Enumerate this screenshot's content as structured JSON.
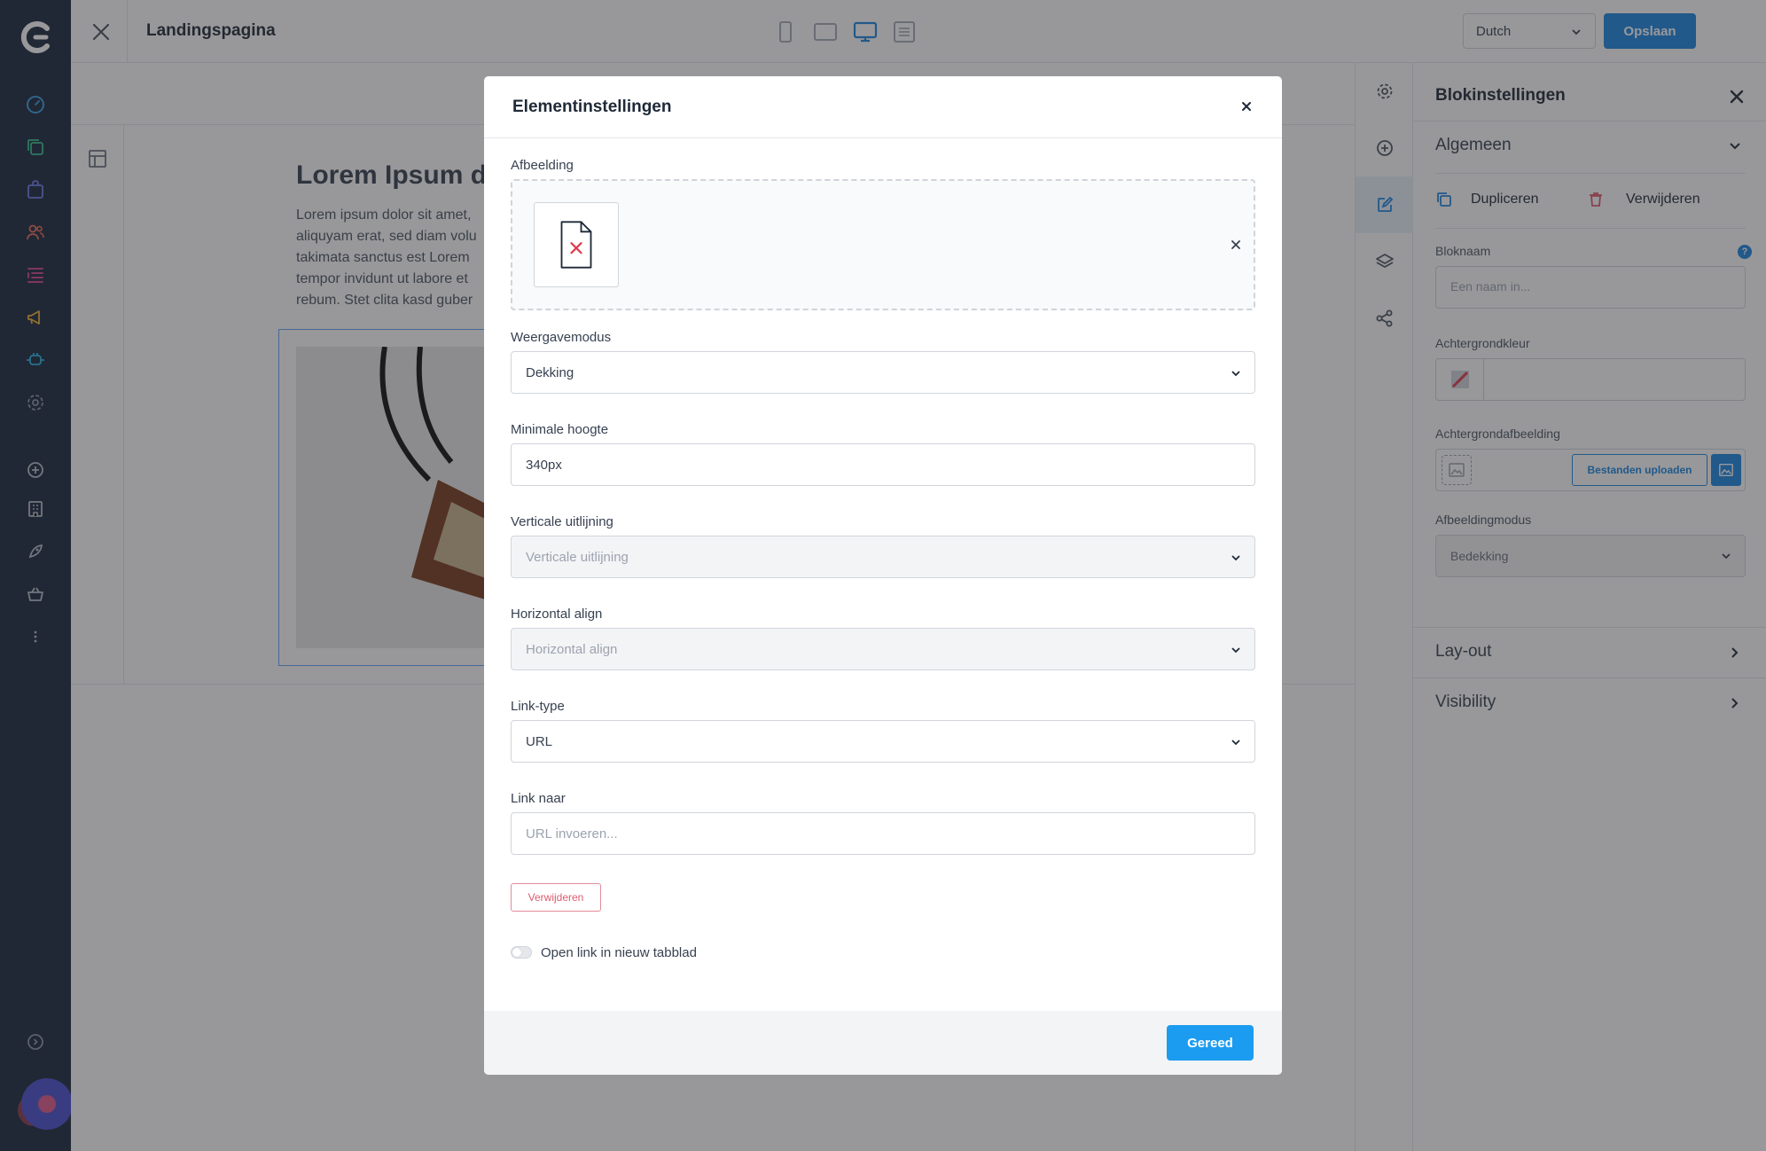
{
  "app": {
    "page_title": "Landingspagina",
    "language": "Dutch",
    "save_label": "Opslaan"
  },
  "colors": {
    "nav_bg": "#1b2a3e",
    "accent": "#1c86e0",
    "done": "#1c9cf0",
    "danger": "#e05a6e"
  },
  "leftnav": {
    "icons": [
      "dashboard-icon",
      "pages-icon",
      "shop-icon",
      "users-icon",
      "content-icon",
      "megaphone-icon",
      "integrations-icon",
      "settings-icon",
      "add-icon",
      "building-icon",
      "rocket-icon",
      "basket-icon",
      "more-icon",
      "help-icon"
    ]
  },
  "devices": [
    "mobile-view-icon",
    "tablet-view-icon",
    "desktop-view-icon",
    "list-view-icon"
  ],
  "preview": {
    "heading": "Lorem Ipsum do",
    "paragraph": "Lorem ipsum dolor sit amet, aliquyam erat, sed diam volu takimata sanctus est Lorem tempor invidunt ut labore et rebum. Stet clita kasd guber"
  },
  "rail": {
    "icons": [
      "settings-gear-icon",
      "add-circle-icon",
      "edit-icon",
      "layers-icon",
      "share-icon"
    ],
    "active": "edit-icon"
  },
  "panel": {
    "title": "Blokinstellingen",
    "general": "Algemeen",
    "duplicate": "Dupliceren",
    "delete": "Verwijderen",
    "block_name_label": "Bloknaam",
    "block_name_placeholder": "Een naam in...",
    "help": "?",
    "bg_color_label": "Achtergrondkleur",
    "bg_image_label": "Achtergrondafbeelding",
    "upload_label": "Bestanden uploaden",
    "image_mode_label": "Afbeeldingmodus",
    "image_mode_value": "Bedekking",
    "layout": "Lay-out",
    "visibility": "Visibility"
  },
  "modal": {
    "title": "Elementinstellingen",
    "image_label": "Afbeelding",
    "display_mode_label": "Weergavemodus",
    "display_mode_value": "Dekking",
    "min_height_label": "Minimale hoogte",
    "min_height_value": "340px",
    "valign_label": "Verticale uitlijning",
    "valign_placeholder": "Verticale uitlijning",
    "halign_label": "Horizontal align",
    "halign_placeholder": "Horizontal align",
    "link_type_label": "Link-type",
    "link_type_value": "URL",
    "link_to_label": "Link naar",
    "link_to_placeholder": "URL invoeren...",
    "remove_label": "Verwijderen",
    "new_tab_label": "Open link in nieuw tabblad",
    "new_tab_on": false,
    "done_label": "Gereed"
  }
}
